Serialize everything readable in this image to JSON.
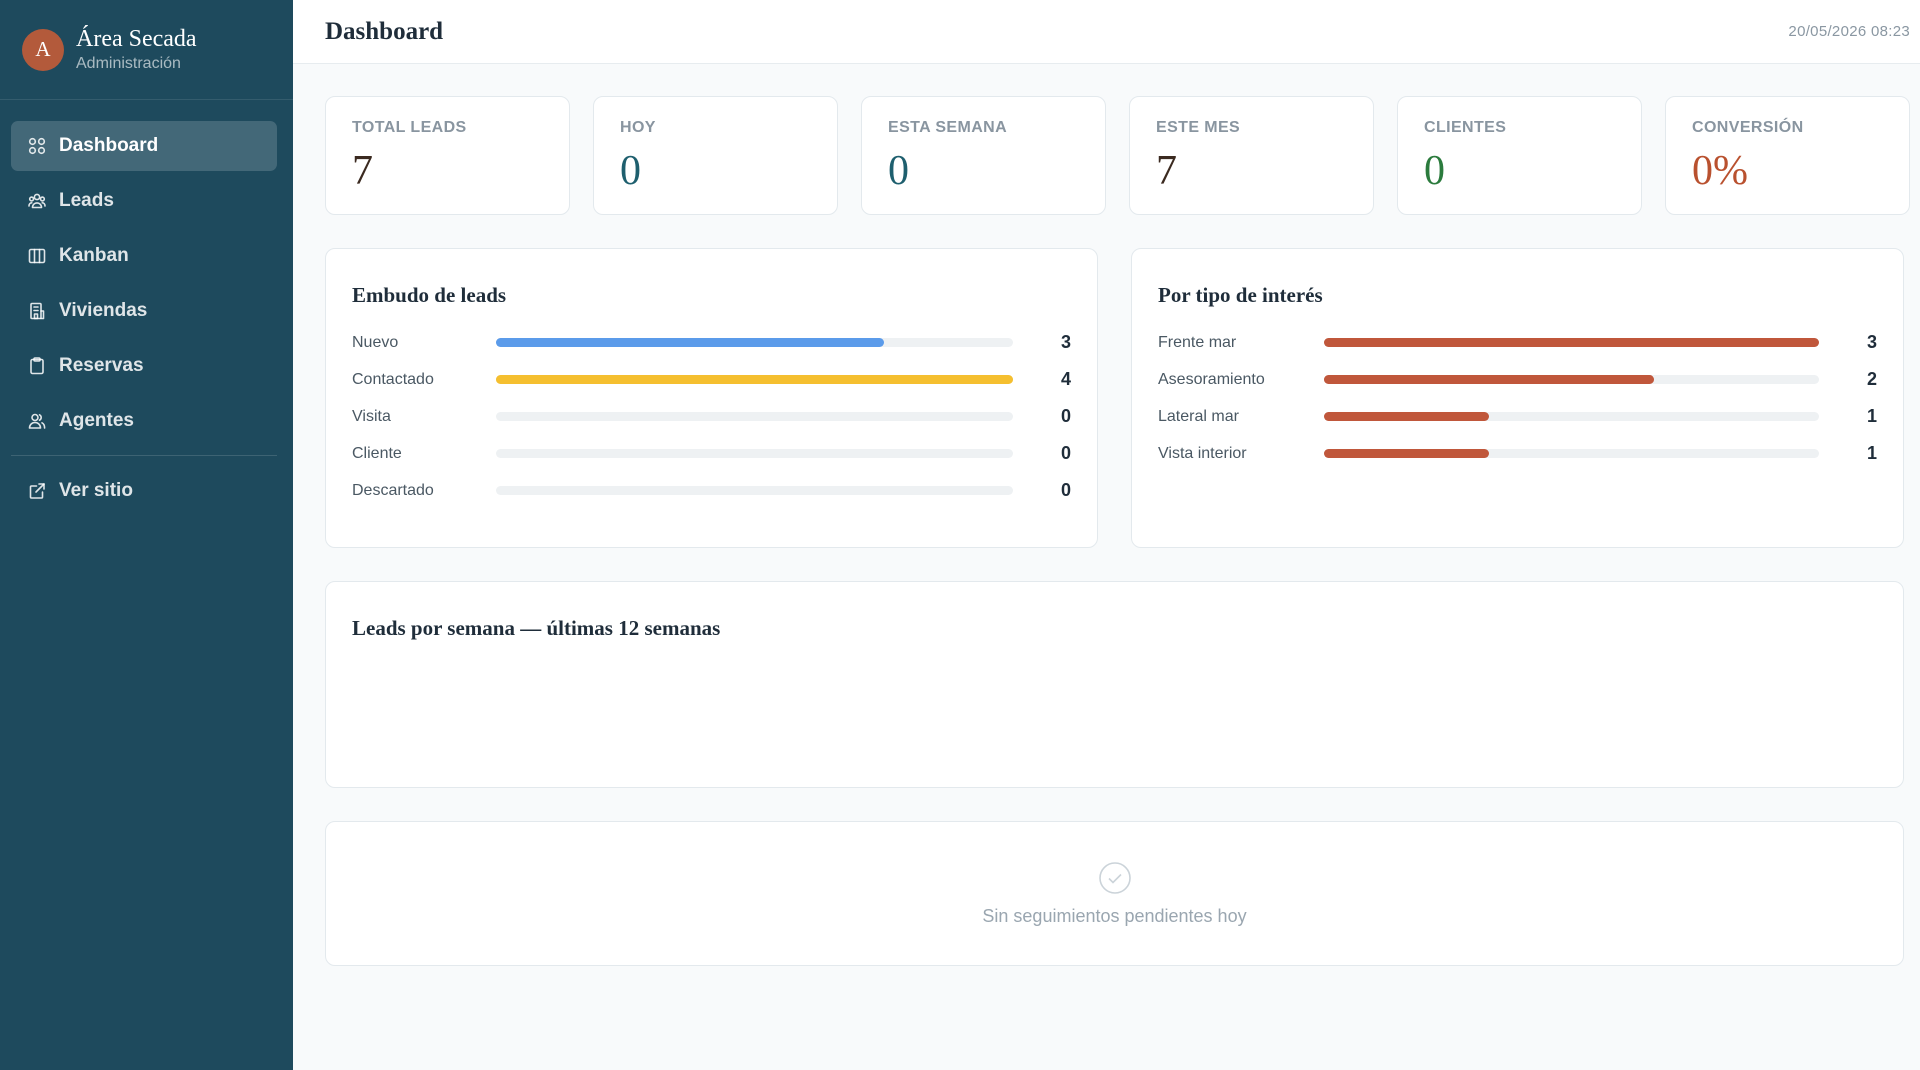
{
  "brand": {
    "initial": "A",
    "name": "Área Secada",
    "subtitle": "Administración"
  },
  "nav": [
    {
      "label": "Dashboard",
      "icon": "grid-icon",
      "active": true
    },
    {
      "label": "Leads",
      "icon": "users-icon"
    },
    {
      "label": "Kanban",
      "icon": "columns-icon"
    },
    {
      "label": "Viviendas",
      "icon": "building-icon"
    },
    {
      "label": "Reservas",
      "icon": "clipboard-icon"
    },
    {
      "label": "Agentes",
      "icon": "user-group-icon"
    },
    {
      "label": "Ver sitio",
      "icon": "external-link-icon"
    }
  ],
  "header": {
    "title": "Dashboard",
    "datetime": "20/05/2026 08:23"
  },
  "stats": [
    {
      "label": "TOTAL LEADS",
      "value": "7",
      "color": "#3b2a20"
    },
    {
      "label": "HOY",
      "value": "0",
      "color": "#1e5f6e"
    },
    {
      "label": "ESTA SEMANA",
      "value": "0",
      "color": "#1e5f6e"
    },
    {
      "label": "ESTE MES",
      "value": "7",
      "color": "#3b2a20"
    },
    {
      "label": "CLIENTES",
      "value": "0",
      "color": "#2b7b3d"
    },
    {
      "label": "CONVERSIÓN",
      "value": "0%",
      "color": "#b9512f"
    }
  ],
  "funnel": {
    "title": "Embudo de leads",
    "max": 4,
    "rows": [
      {
        "label": "Nuevo",
        "count": 3,
        "color": "#5b9bea"
      },
      {
        "label": "Contactado",
        "count": 4,
        "color": "#f5bf2f"
      },
      {
        "label": "Visita",
        "count": 0,
        "color": "#5b9bea"
      },
      {
        "label": "Cliente",
        "count": 0,
        "color": "#5b9bea"
      },
      {
        "label": "Descartado",
        "count": 0,
        "color": "#5b9bea"
      }
    ]
  },
  "interest": {
    "title": "Por tipo de interés",
    "max": 3,
    "rows": [
      {
        "label": "Frente mar",
        "count": 3,
        "color": "#c0573b"
      },
      {
        "label": "Asesoramiento",
        "count": 2,
        "color": "#c0573b"
      },
      {
        "label": "Lateral mar",
        "count": 1,
        "color": "#c0573b"
      },
      {
        "label": "Vista interior",
        "count": 1,
        "color": "#c0573b"
      }
    ]
  },
  "weekly": {
    "title": "Leads por semana — últimas 12 semanas"
  },
  "followups": {
    "empty_text": "Sin seguimientos pendientes hoy"
  }
}
